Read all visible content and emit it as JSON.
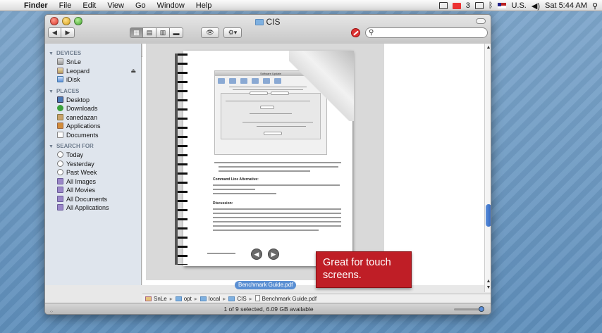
{
  "menubar": {
    "apple_glyph": "",
    "app_name": "Finder",
    "items": [
      "File",
      "Edit",
      "View",
      "Go",
      "Window",
      "Help"
    ],
    "gmail_count": "3",
    "input_source": "U.S.",
    "clock": "Sat 5:44 AM"
  },
  "window": {
    "title": "CIS",
    "search_placeholder": ""
  },
  "sidebar": {
    "sections": [
      {
        "heading": "DEVICES",
        "items": [
          {
            "label": "SnLe",
            "icon": "disk-icon"
          },
          {
            "label": "Leopard",
            "icon": "disk-icon",
            "eject": true
          },
          {
            "label": "iDisk",
            "icon": "idisk-icon"
          }
        ]
      },
      {
        "heading": "PLACES",
        "items": [
          {
            "label": "Desktop",
            "icon": "desktop-icon"
          },
          {
            "label": "Downloads",
            "icon": "downloads-icon"
          },
          {
            "label": "canedazan",
            "icon": "home-icon"
          },
          {
            "label": "Applications",
            "icon": "applications-icon"
          },
          {
            "label": "Documents",
            "icon": "documents-icon"
          }
        ]
      },
      {
        "heading": "SEARCH FOR",
        "items": [
          {
            "label": "Today",
            "icon": "clock-icon"
          },
          {
            "label": "Yesterday",
            "icon": "clock-icon"
          },
          {
            "label": "Past Week",
            "icon": "clock-icon"
          },
          {
            "label": "All Images",
            "icon": "smart-folder-icon"
          },
          {
            "label": "All Movies",
            "icon": "smart-folder-icon"
          },
          {
            "label": "All Documents",
            "icon": "smart-folder-icon"
          },
          {
            "label": "All Applications",
            "icon": "smart-folder-icon"
          }
        ]
      }
    ]
  },
  "preview": {
    "mini_window_title": "Software Update",
    "command_line_heading": "Command Line Alternative:",
    "discussion_heading": "Discussion:",
    "doc_name": "Benchmark Guide.pdf"
  },
  "tooltip": {
    "text": "Great for touch screens."
  },
  "pathbar": [
    "SnLe",
    "opt",
    "local",
    "CIS",
    "Benchmark Guide.pdf"
  ],
  "status": {
    "text": "1 of 9 selected, 6.09 GB available"
  },
  "colors": {
    "accent": "#5a8fd3",
    "tooltip_bg": "#bf1e26",
    "sidebar_bg": "#dfe5ed"
  }
}
